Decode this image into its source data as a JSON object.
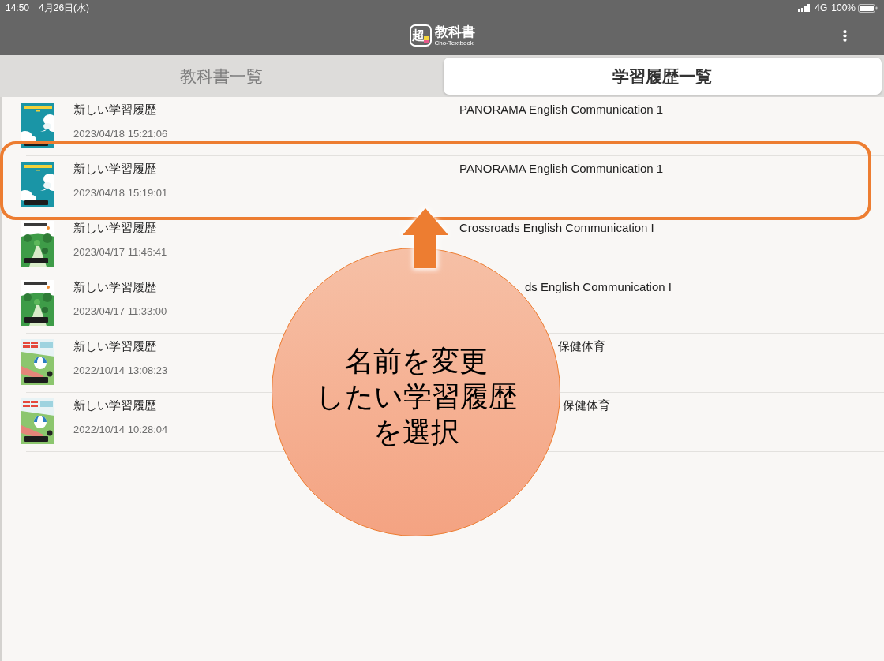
{
  "status_bar": {
    "time": "14:50",
    "date": "4月26日(水)",
    "network": "4G",
    "battery": "100%"
  },
  "header": {
    "logo_mark": "超",
    "logo_title": "教科書",
    "logo_subtitle": "Cho-Textbook"
  },
  "tabs": [
    {
      "label": "教科書一覧",
      "selected": false
    },
    {
      "label": "学習履歴一覧",
      "selected": true
    }
  ],
  "history": [
    {
      "kind": "sky",
      "title": "新しい学習履歴",
      "date": "2023/04/18 15:21:06",
      "book_title": "PANORAMA English Communication 1",
      "highlighted": false
    },
    {
      "kind": "sky",
      "title": "新しい学習履歴",
      "date": "2023/04/18 15:19:01",
      "book_title": "PANORAMA English Communication 1",
      "highlighted": true
    },
    {
      "kind": "park",
      "title": "新しい学習履歴",
      "date": "2023/04/17 11:46:41",
      "book_title": "Crossroads English Communication I",
      "highlighted": false
    },
    {
      "kind": "park",
      "title": "新しい学習履歴",
      "date": "2023/04/17 11:33:00",
      "book_title": "ds English Communication I",
      "highlighted": false
    },
    {
      "kind": "town",
      "title": "新しい学習履歴",
      "date": "2022/10/14 13:08:23",
      "book_title": "保健体育",
      "highlighted": false
    },
    {
      "kind": "town",
      "title": "新しい学習履歴",
      "date": "2022/10/14 10:28:04",
      "book_title": "保健体育",
      "highlighted": false
    }
  ],
  "callout": {
    "lines": [
      "名前を変更",
      "したい学習履歴",
      "を選択"
    ]
  }
}
